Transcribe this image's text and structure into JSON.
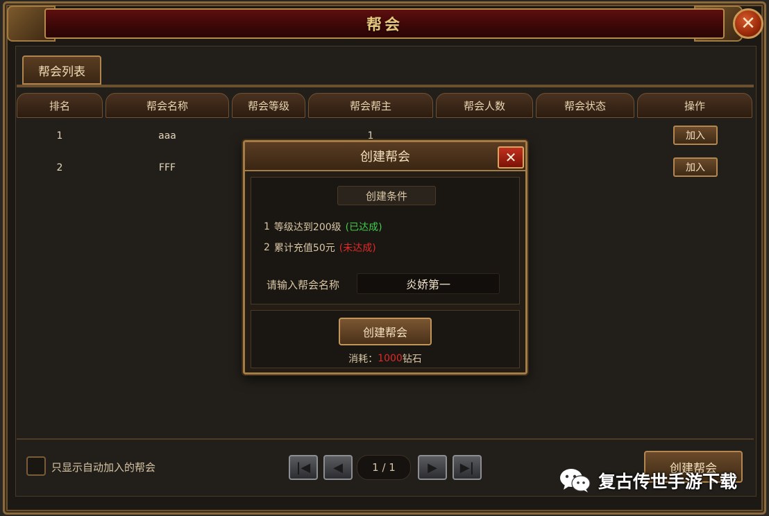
{
  "window": {
    "title": "帮会",
    "close_glyph": "✕"
  },
  "tab": {
    "label": "帮会列表"
  },
  "table": {
    "columns": [
      "排名",
      "帮会名称",
      "帮会等级",
      "帮会帮主",
      "帮会人数",
      "帮会状态",
      "操作"
    ],
    "rows": [
      {
        "rank": "1",
        "name": "aaa",
        "level": "",
        "leader": "1",
        "members": "",
        "status": "",
        "action": "加入"
      },
      {
        "rank": "2",
        "name": "FFF",
        "level": "",
        "leader": "",
        "members": "",
        "status": "",
        "action": "加入"
      }
    ]
  },
  "footer": {
    "auto_join_label": "只显示自动加入的帮会",
    "page_indicator": "1 / 1",
    "create_button": "创建帮会"
  },
  "modal": {
    "title": "创建帮会",
    "close_glyph": "✕",
    "conditions_title": "创建条件",
    "conditions": [
      {
        "num": "1",
        "text": "等级达到200级",
        "status": "(已达成)",
        "met": true
      },
      {
        "num": "2",
        "text": "累计充值50元",
        "status": "(未达成)",
        "met": false
      }
    ],
    "name_label": "请输入帮会名称",
    "name_value": "炎娇第一",
    "create_button": "创建帮会",
    "cost_prefix": "消耗：",
    "cost_amount": "1000",
    "cost_unit": "钻石"
  },
  "watermark": {
    "text": "复古传世手游下载",
    "icon": "wechat-icon"
  },
  "colors": {
    "met": "#3fcf4a",
    "unmet": "#e02a2a",
    "gold": "#b3874f"
  }
}
